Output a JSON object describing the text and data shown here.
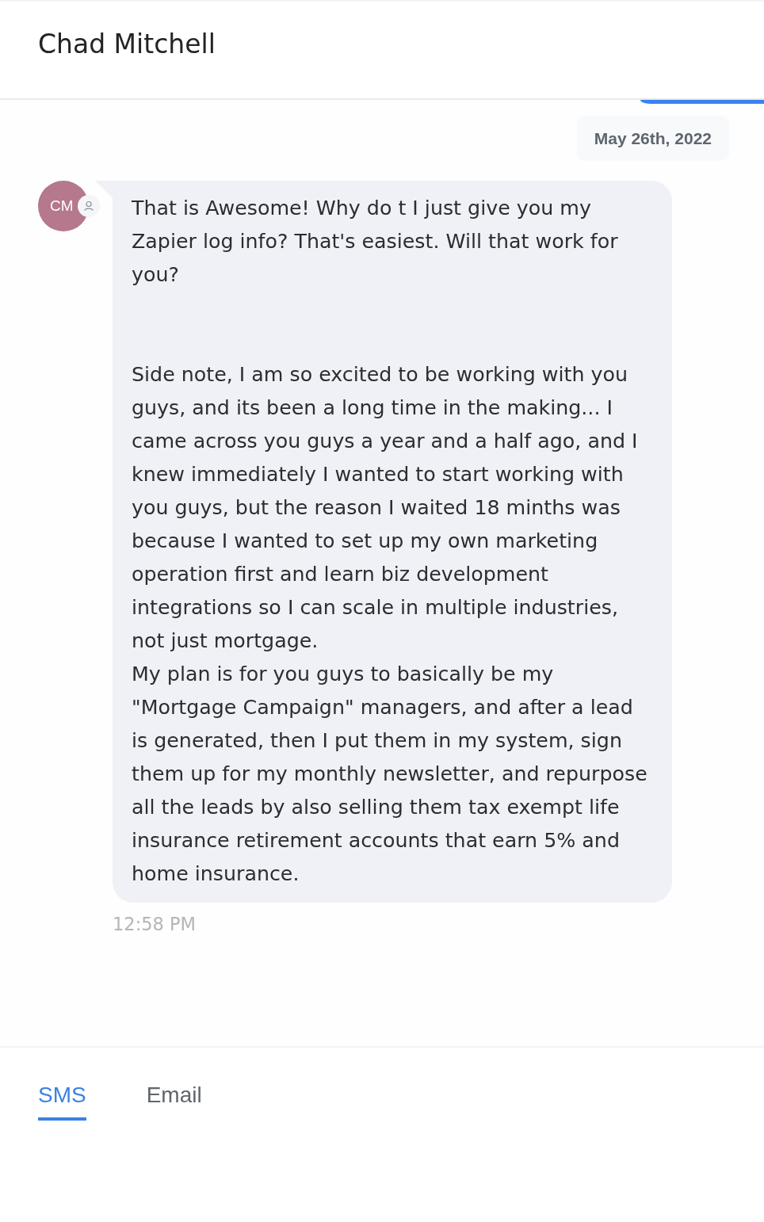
{
  "header": {
    "title": "Chad Mitchell"
  },
  "thread": {
    "date_label": "May 26th, 2022",
    "messages": [
      {
        "avatar": {
          "initials": "CM",
          "color": "#b5788c"
        },
        "text": "That is Awesome! Why do t I just give you my Zapier log info? That's easiest. Will that work for you?\n\n\nSide note, I am so excited to be working with you guys, and its been a long time in the making... I came across you guys a year and a half ago, and I knew immediately I wanted to start working with you guys, but the reason I waited 18 minths was because I wanted to set up my own marketing operation first and learn biz development integrations so I can scale in multiple industries, not just mortgage.\nMy plan is for you guys to basically be my \"Mortgage Campaign\" managers, and after a lead is generated, then I put them in my system, sign them up for my monthly newsletter, and repurpose all the leads by also selling them tax exempt life insurance retirement accounts that earn 5% and home insurance.",
        "time": "12:58 PM"
      }
    ]
  },
  "channel_tabs": [
    {
      "label": "SMS",
      "selected": true
    },
    {
      "label": "Email",
      "selected": false
    }
  ]
}
